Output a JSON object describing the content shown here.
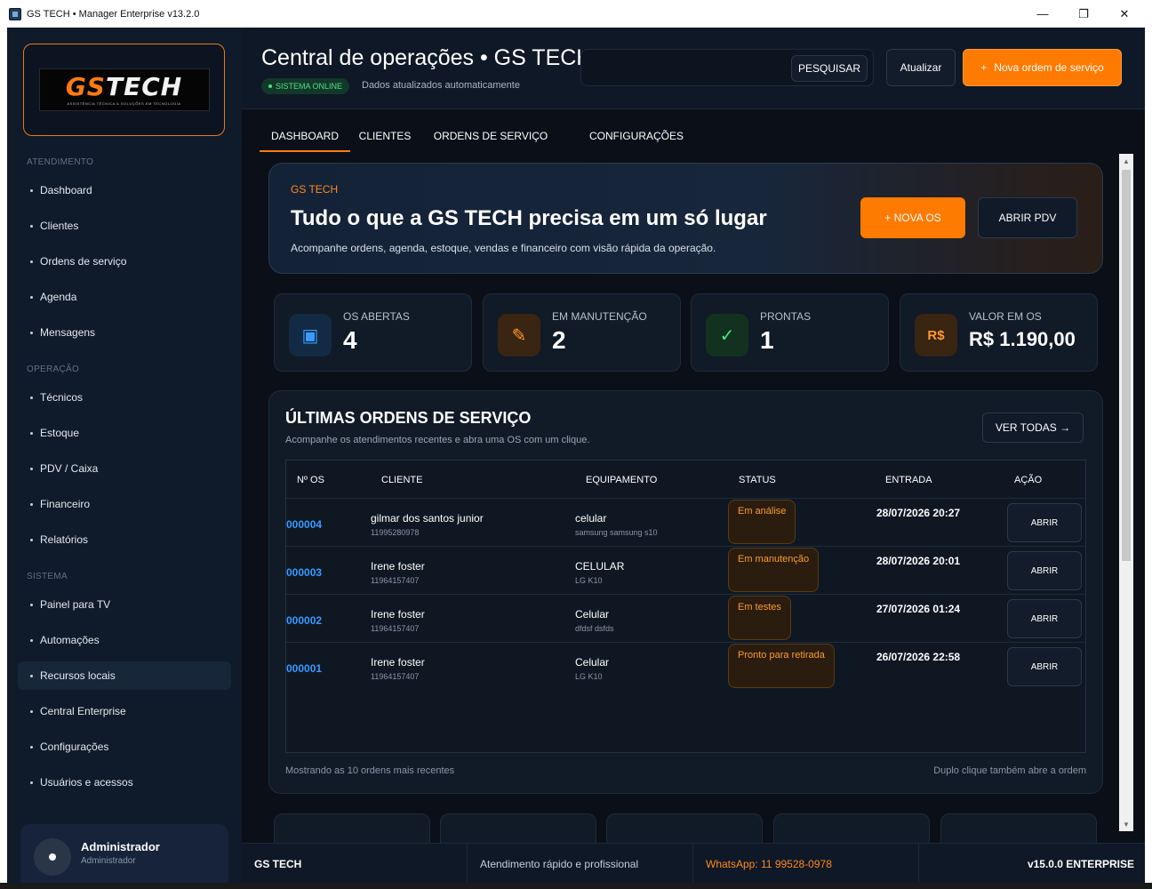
{
  "window": {
    "title": "GS TECH • Manager Enterprise v13.2.0",
    "controls": {
      "minimize": "—",
      "maximize": "❐",
      "close": "✕"
    }
  },
  "sidebar": {
    "logo": {
      "brand_gs": "GS",
      "brand_tech": "TECH",
      "tagline": "ASSISTÊNCIA TÉCNICA & SOLUÇÕES EM TECNOLOGIA"
    },
    "sections": [
      {
        "label": "ATENDIMENTO",
        "items": [
          "Dashboard",
          "Clientes",
          "Ordens de serviço",
          "Agenda",
          "Mensagens"
        ]
      },
      {
        "label": "OPERAÇÃO",
        "items": [
          "Técnicos",
          "Estoque",
          "PDV / Caixa",
          "Financeiro",
          "Relatórios"
        ]
      },
      {
        "label": "SISTEMA",
        "items": [
          "Painel para TV",
          "Automações",
          "Recursos locais",
          "Central Enterprise",
          "Configurações",
          "Usuários e acessos"
        ]
      }
    ],
    "active_item": "Recursos locais",
    "user": {
      "name": "Administrador",
      "role": "Administrador"
    }
  },
  "header": {
    "title": "Central de operações • GS TECH",
    "status_badge": "SISTEMA ONLINE",
    "updated_text": "Dados atualizados automaticamente",
    "search": {
      "value": "",
      "placeholder": "",
      "button": "PESQUISAR"
    },
    "refresh_button": "Atualizar",
    "new_order_button": "Nova ordem de serviço",
    "new_order_plus": "+"
  },
  "tabs": [
    "DASHBOARD",
    "CLIENTES",
    "ORDENS DE SERVIÇO",
    "CONFIGURAÇÕES"
  ],
  "active_tab": "DASHBOARD",
  "hero": {
    "brand": "GS TECH",
    "title": "Tudo o que a GS TECH precisa em um só lugar",
    "subtitle": "Acompanhe ordens, agenda, estoque, vendas e financeiro com visão rápida da operação.",
    "new_os_button": "+ NOVA OS",
    "pdv_button": "ABRIR PDV"
  },
  "stats": [
    {
      "label": "OS ABERTAS",
      "value": "4",
      "icon": "board-icon",
      "glyph": "▣",
      "icon_color": "#3a9bff",
      "icon_bg": "#132a44"
    },
    {
      "label": "EM MANUTENÇÃO",
      "value": "2",
      "icon": "pencil-icon",
      "glyph": "✎",
      "icon_color": "#ff9a2e",
      "icon_bg": "#3a2412"
    },
    {
      "label": "PRONTAS",
      "value": "1",
      "icon": "check-icon",
      "glyph": "✓",
      "icon_color": "#4ee088",
      "icon_bg": "#12321f"
    },
    {
      "label": "VALOR EM OS",
      "value": "R$ 1.190,00",
      "icon": "currency-icon",
      "glyph": "R$",
      "icon_color": "#ff9a2e",
      "icon_bg": "#3a2412"
    }
  ],
  "orders": {
    "title": "ÚLTIMAS ORDENS DE SERVIÇO",
    "subtitle": "Acompanhe os atendimentos recentes e abra uma OS com um clique.",
    "view_all_button": "VER TODAS →",
    "columns": [
      "Nº OS",
      "CLIENTE",
      "EQUIPAMENTO",
      "STATUS",
      "ENTRADA",
      "AÇÃO"
    ],
    "rows": [
      {
        "id": "000004",
        "client": "gilmar dos santos junior",
        "phone": "11995280978",
        "equipment": "celular",
        "model": "samsung  samsung s10",
        "status": "Em análise",
        "date": "28/07/2026 20:27",
        "action": "ABRIR"
      },
      {
        "id": "000003",
        "client": "Irene foster",
        "phone": "11964157407",
        "equipment": "CELULAR",
        "model": "LG  K10",
        "status": "Em manutenção",
        "date": "28/07/2026 20:01",
        "action": "ABRIR"
      },
      {
        "id": "000002",
        "client": "Irene foster",
        "phone": "11964157407",
        "equipment": "Celular",
        "model": "dfdsf  dsfds",
        "status": "Em testes",
        "date": "27/07/2026 01:24",
        "action": "ABRIR"
      },
      {
        "id": "000001",
        "client": "Irene foster",
        "phone": "11964157407",
        "equipment": "Celular",
        "model": "LG  K10",
        "status": "Pronto para retirada",
        "date": "26/07/2026 22:58",
        "action": "ABRIR"
      }
    ],
    "footer_left": "Mostrando as 10 ordens mais recentes",
    "footer_right": "Duplo clique também abre a ordem"
  },
  "footer": {
    "brand": "GS TECH",
    "tagline": "Atendimento rápido e profissional",
    "whatsapp": "WhatsApp: 11 99528-0978",
    "version": "v15.0.0 ENTERPRISE"
  },
  "colors": {
    "accent": "#ff7a00",
    "link": "#3a9bff",
    "online": "#4ee088",
    "background": "#0b0f17",
    "sidebar": "#0f1a2a"
  }
}
